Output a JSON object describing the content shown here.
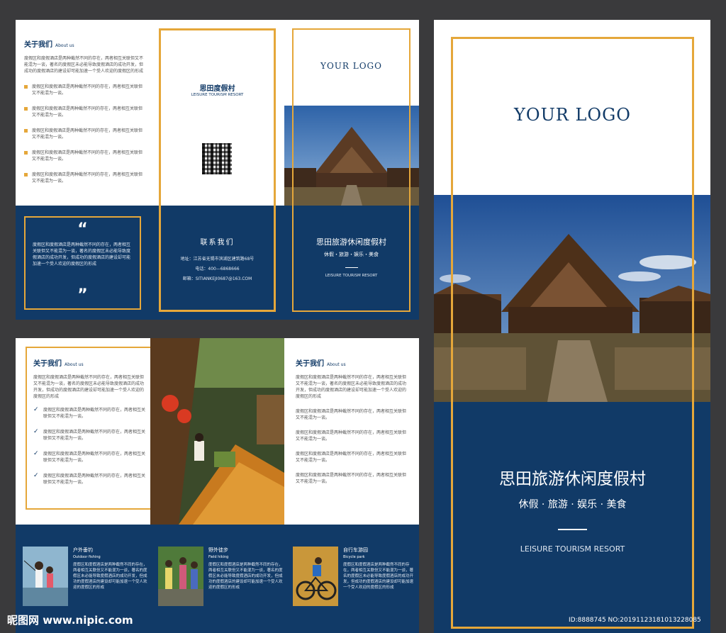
{
  "about": {
    "title": "关于我们",
    "title_en": "About us",
    "intro": "度假区和度假酒店是两种截然不同的存在，两者相互关联但又不能混为一谈，著名的度假区未必能导致度假酒店的成功开发，但成功的度假酒店的建设却可能加速一个受人欢迎的度假区的形成",
    "bullets": [
      "度假区和度假酒店是两种截然不同的存在，两者相互关联但又不能混为一谈。",
      "度假区和度假酒店是两种截然不同的存在，两者相互关联但又不能混为一谈。",
      "度假区和度假酒店是两种截然不同的存在，两者相互关联但又不能混为一谈。",
      "度假区和度假酒店是两种截然不同的存在，两者相互关联但又不能混为一谈。",
      "度假区和度假酒店是两种截然不同的存在，两者相互关联但又不能混为一谈。"
    ],
    "quote_open": "“",
    "quote_close": "”",
    "quote_text": "度假区和度假酒店是两种截然不同的存在，两者相互关联但又不能混为一谈，著名的度假区未必能导致度假酒店的成功开发，但成功的度假酒店的建设却可能加速一个受人欢迎的度假区的形成"
  },
  "brand": {
    "logo": "YOUR LOGO",
    "name_short": "思田度假村",
    "tagline_en": "LEISURE TOURISM RESORT",
    "name_full": "思田旅游休闲度假村",
    "slogan": "休假・旅游・娱乐・美食",
    "slogan_large": "休假 · 旅游 · 娱乐 · 美食"
  },
  "contact": {
    "title": "联系我们",
    "address": "地址：江苏省无锡市滨湖区建筑路68号",
    "phone": "电话：400—6868666",
    "email": "邮箱：SITIANKEJI0687@163.COM"
  },
  "activities": [
    {
      "title": "户外垂钓",
      "subtitle": "Outdoor fishing",
      "text": "度假区和度假酒店是两种截然不同的存在，两者相互关联但又不能混为一谈，著名的度假区未必能导致度假酒店的成功开发，但成功的度假酒店的建设却可能加速一个受人欢迎的度假区的形成"
    },
    {
      "title": "野外徒步",
      "subtitle": "Field hiking",
      "text": "度假区和度假酒店是两种截然不同的存在，两者相互关联但又不能混为一谈，著名的度假区未必能导致度假酒店的成功开发，但成功的度假酒店的建设却可能加速一个受人欢迎的度假区的形成"
    },
    {
      "title": "自行车游园",
      "subtitle": "Bicycle park",
      "text": "度假区和度假酒店是两种截然不同的存在，两者相互关联但又不能混为一谈，著名的度假区未必能导致度假酒店的成功开发，但成功的度假酒店的建设却可能加速一个受人欢迎的度假区的形成"
    }
  ],
  "watermark": {
    "site": "昵图网 www.nipic.com",
    "id": "ID:8888745 NO:20191123181013228085"
  },
  "colors": {
    "navy": "#113a67",
    "gold": "#e5a73a",
    "background": "#3a3a3c"
  }
}
